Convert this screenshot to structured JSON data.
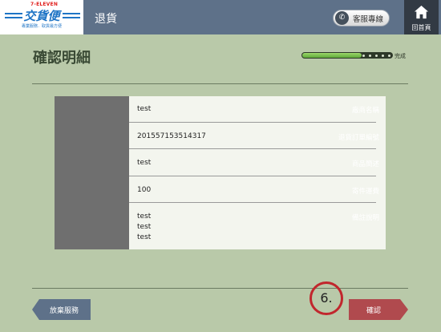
{
  "header": {
    "logo": {
      "brand": "7-ELEVEN",
      "name": "交貨便",
      "tagline": "專業服務．取貨最方便"
    },
    "title": "退貨",
    "customer_service_label": "客服專線",
    "home_label": "回首頁"
  },
  "page": {
    "title": "確認明細",
    "progress": {
      "value_percent": 66,
      "label": "完成"
    }
  },
  "details": {
    "rows": [
      {
        "label": "廠商名稱",
        "value": "test"
      },
      {
        "label": "退貨訂單編號",
        "value": "201557153514317"
      },
      {
        "label": "商品簡述",
        "value": "test"
      },
      {
        "label": "寄件運費",
        "value": "100"
      },
      {
        "label": "備註說明",
        "values": [
          "test",
          "test",
          "test"
        ]
      }
    ]
  },
  "footer": {
    "cancel_label": "放棄服務",
    "confirm_label": "確認",
    "annotation": "6."
  },
  "colors": {
    "background": "#b9c9a9",
    "header": "#5e7189",
    "home": "#323a44",
    "progress": "#7cc24e",
    "label_column": "#6f6f6f",
    "cancel_button": "#5e7189",
    "confirm_button": "#b04a4e",
    "annotation": "#c1272d"
  },
  "icons": [
    "phone-icon",
    "home-icon"
  ]
}
